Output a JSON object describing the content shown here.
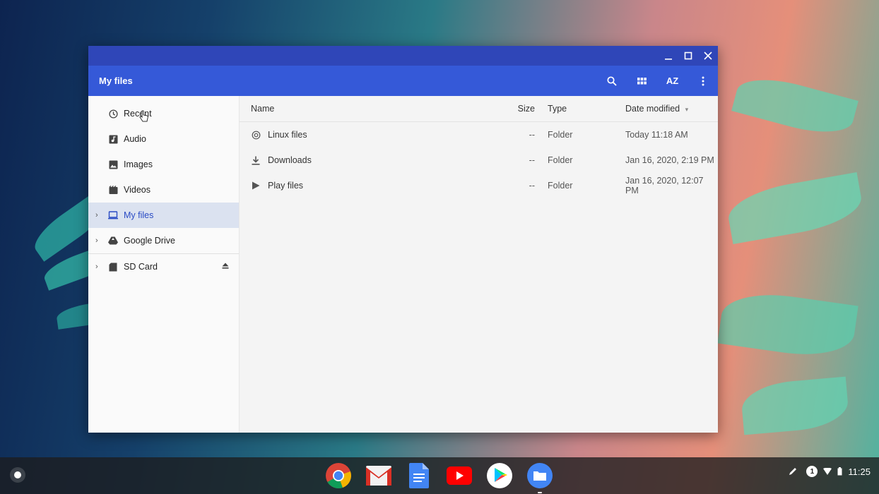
{
  "window": {
    "title": "My files",
    "controls": {
      "minimize": "minimize-icon",
      "maximize": "maximize-icon",
      "close": "close-icon"
    },
    "toolbar": {
      "search": "search-icon",
      "grid_view": "grid-view-icon",
      "sort": "AZ",
      "more": "more-vert-icon"
    }
  },
  "sidebar": {
    "items": [
      {
        "label": "Recent",
        "icon": "clock-icon"
      },
      {
        "label": "Audio",
        "icon": "audio-icon"
      },
      {
        "label": "Images",
        "icon": "image-icon"
      },
      {
        "label": "Videos",
        "icon": "video-icon"
      },
      {
        "label": "My files",
        "icon": "laptop-icon",
        "selected": true
      },
      {
        "label": "Google Drive",
        "icon": "drive-icon"
      },
      {
        "label": "SD Card",
        "icon": "sd-card-icon"
      }
    ]
  },
  "table": {
    "headers": {
      "name": "Name",
      "size": "Size",
      "type": "Type",
      "date": "Date modified"
    },
    "rows": [
      {
        "name": "Linux files",
        "size": "--",
        "type": "Folder",
        "date": "Today 11:18 AM",
        "icon": "linux-icon"
      },
      {
        "name": "Downloads",
        "size": "--",
        "type": "Folder",
        "date": "Jan 16, 2020, 2:19 PM",
        "icon": "download-icon"
      },
      {
        "name": "Play files",
        "size": "--",
        "type": "Folder",
        "date": "Jan 16, 2020, 12:07 PM",
        "icon": "play-files-icon"
      }
    ]
  },
  "shelf": {
    "apps": [
      "Chrome",
      "Gmail",
      "Docs",
      "YouTube",
      "Play Store",
      "Files"
    ],
    "tray": {
      "notification_count": "1",
      "time": "11:25"
    }
  },
  "colors": {
    "title_bar": "#2f46b8",
    "app_bar": "#3559d8",
    "selection": "#dbe2f0",
    "accent": "#2a4bc4"
  }
}
